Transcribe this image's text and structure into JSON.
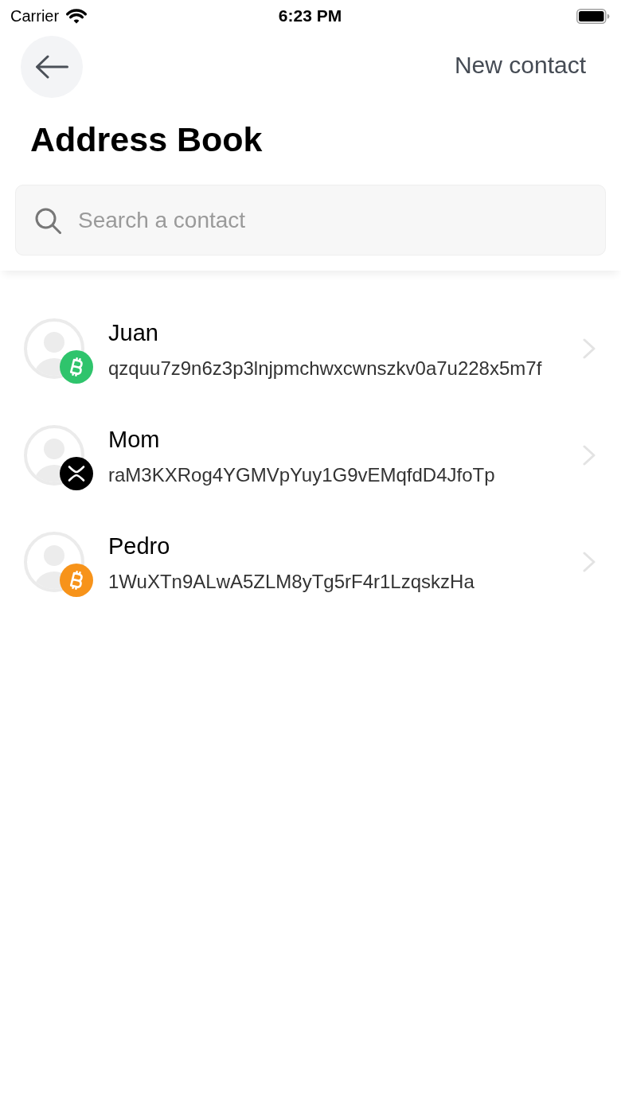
{
  "status_bar": {
    "carrier": "Carrier",
    "time": "6:23 PM"
  },
  "header": {
    "action": "New contact",
    "title": "Address Book"
  },
  "search": {
    "placeholder": "Search a contact"
  },
  "contacts": [
    {
      "name": "Juan",
      "address": "qzquu7z9n6z3p3lnjpmchwxcwnszkv0a7u228x5m7f",
      "coin": {
        "kind": "bitcoin",
        "color": "#2fc46c"
      }
    },
    {
      "name": "Mom",
      "address": "raM3KXRog4YGMVpYuy1G9vEMqfdD4JfoTp",
      "coin": {
        "kind": "xrp",
        "color": "#000000"
      }
    },
    {
      "name": "Pedro",
      "address": "1WuXTn9ALwA5ZLM8yTg5rF4r1LzqskzHa",
      "coin": {
        "kind": "bitcoin",
        "color": "#f7931a"
      }
    }
  ]
}
